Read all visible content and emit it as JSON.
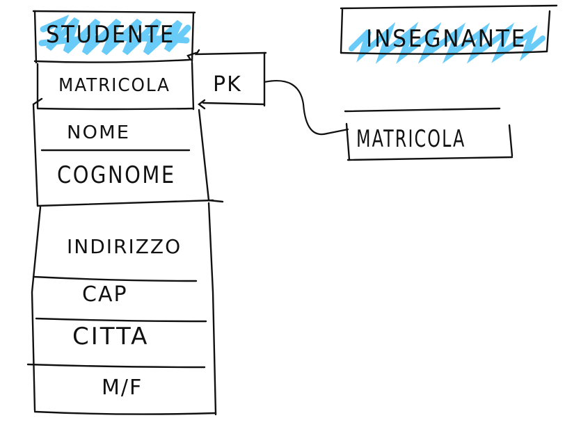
{
  "colors": {
    "ink": "#111111",
    "highlight": "#4fc3f7"
  },
  "entities": {
    "studente": {
      "title": "STUDENTE",
      "fields": {
        "matricola": "MATRICOLA",
        "nome": "NOME",
        "cognome": "COGNOME",
        "indirizzo": "INDIRIZZO",
        "cap": "CAP",
        "citta": "CITTA",
        "sesso": "M/F"
      }
    },
    "insegnante": {
      "title": "INSEGNANTE"
    },
    "matricola_box": {
      "label": "MATRICOLA"
    }
  },
  "relation": {
    "label": "PK"
  }
}
